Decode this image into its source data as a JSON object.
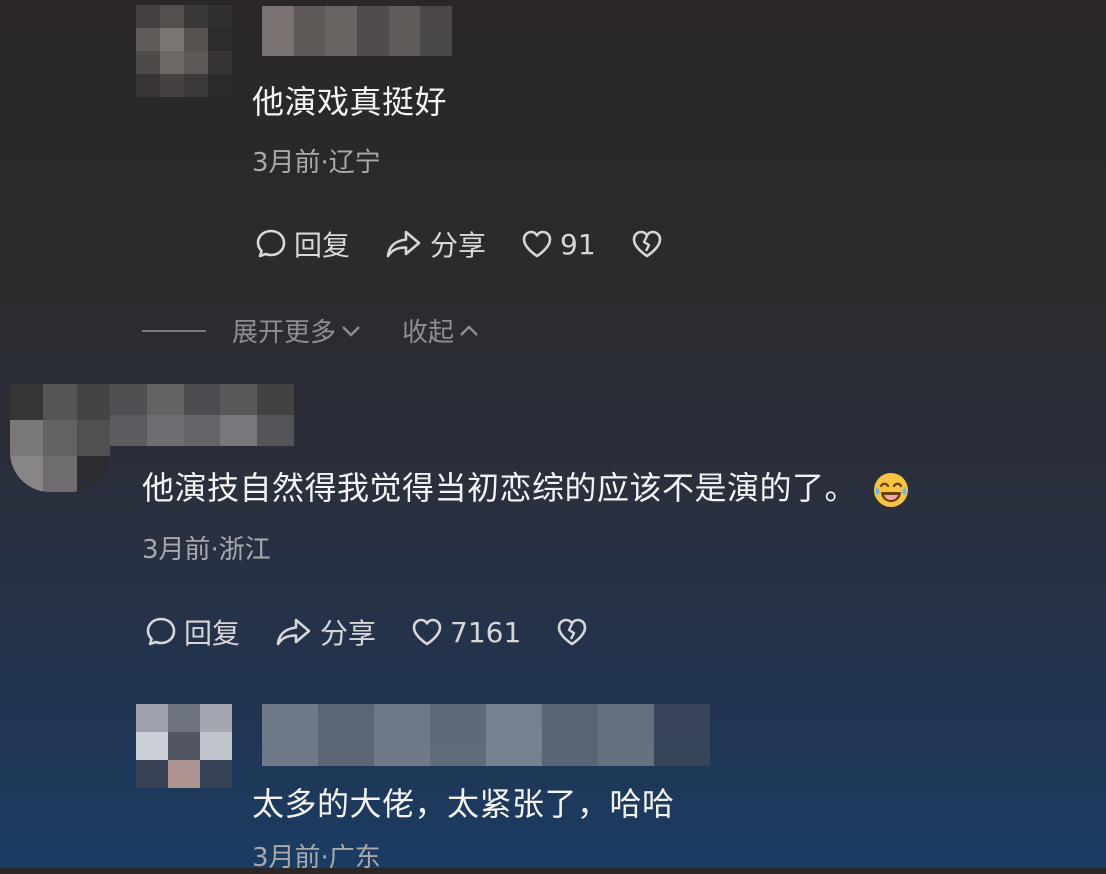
{
  "comments": [
    {
      "text": "他演戏真挺好",
      "meta": "3月前·辽宁",
      "reply_label": "回复",
      "share_label": "分享",
      "likes": "91"
    },
    {
      "text": "他演技自然得我觉得当初恋综的应该不是演的了。",
      "emoji": "laughing-crying-emoji",
      "meta": "3月前·浙江",
      "reply_label": "回复",
      "share_label": "分享",
      "likes": "7161"
    },
    {
      "text": "太多的大佬，太紧张了，哈哈",
      "meta": "3月前·广东"
    }
  ],
  "thread_controls": {
    "expand_label": "展开更多",
    "collapse_label": "收起"
  },
  "colors": {
    "text": "#f4f4f4",
    "meta": "#a9a9ab",
    "action": "#d7d7d9",
    "emoji": "#f6c343"
  }
}
